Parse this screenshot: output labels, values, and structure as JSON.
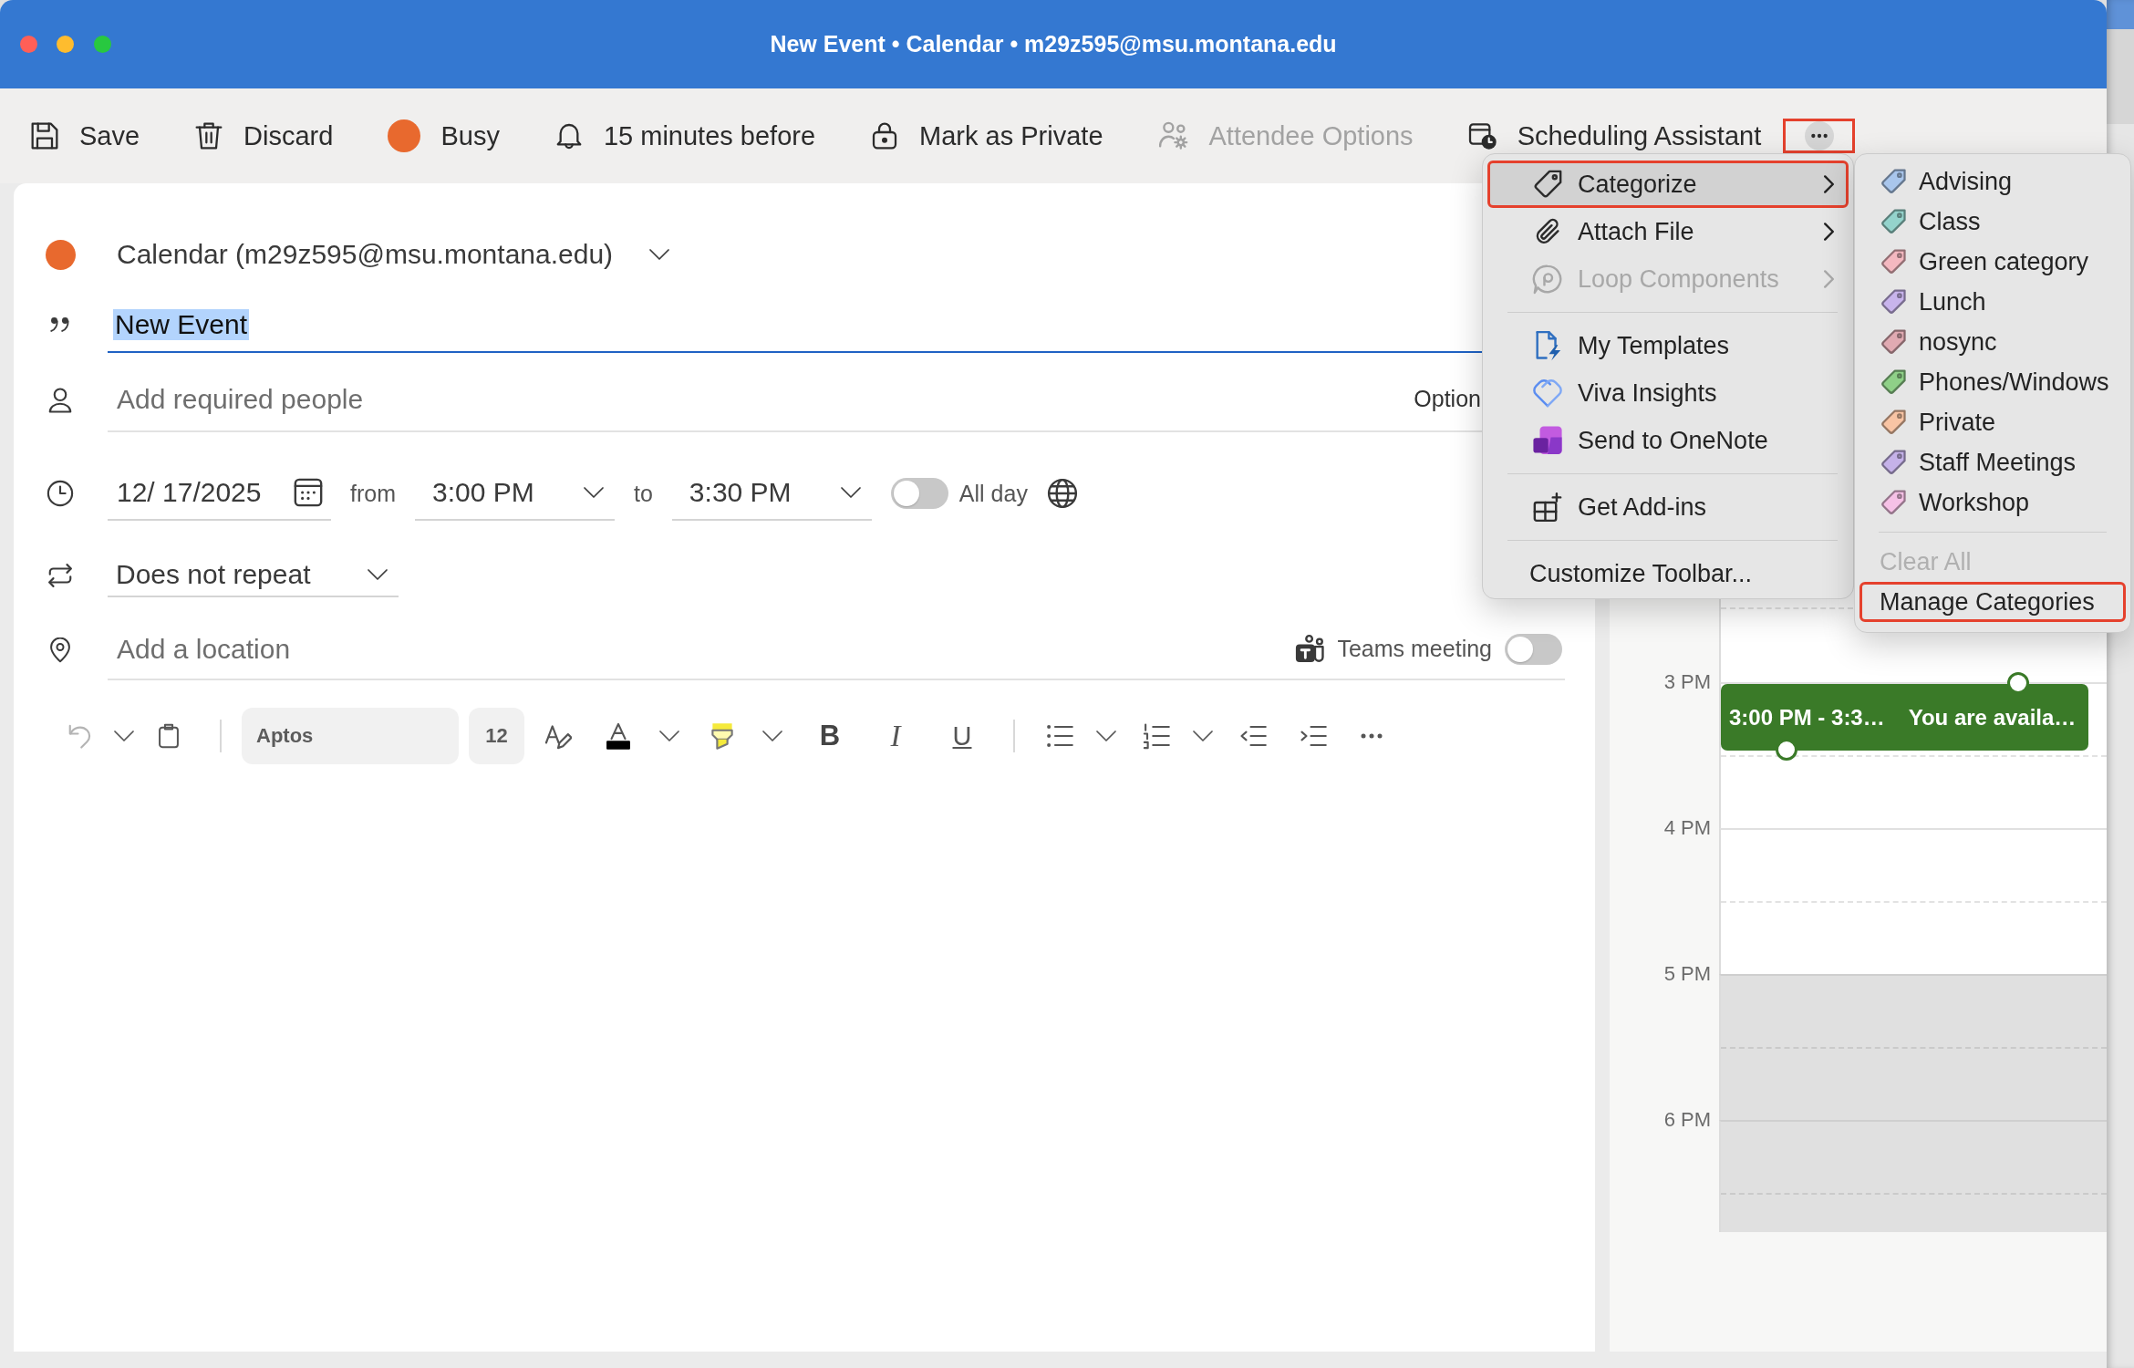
{
  "window": {
    "title": "New Event • Calendar • m29z595@msu.montana.edu"
  },
  "toolbar": {
    "buttons": [
      {
        "label": "Save",
        "disabled": false
      },
      {
        "label": "Discard",
        "disabled": false
      },
      {
        "label": "Busy",
        "disabled": false
      },
      {
        "label": "15 minutes before",
        "disabled": false
      },
      {
        "label": "Mark as Private",
        "disabled": false
      },
      {
        "label": "Attendee Options",
        "disabled": true
      },
      {
        "label": "Scheduling Assistant",
        "disabled": false
      }
    ],
    "more_button": {
      "highlighted": true
    }
  },
  "event_form": {
    "calendar": "Calendar (m29z595@msu.montana.edu)",
    "title": {
      "value": "New Event",
      "text_selected": true
    },
    "attendees": {
      "placeholder": "Add required people",
      "options_link": "Option"
    },
    "date": "12/ 17/2025",
    "from_label": "from",
    "start_time": "3:00 PM",
    "to_label": "to",
    "end_time": "3:30 PM",
    "all_day": {
      "label": "All day",
      "on": false
    },
    "repeat": "Does not repeat",
    "location": {
      "placeholder": "Add a location"
    },
    "teams_meeting": {
      "label": "Teams meeting",
      "on": false
    }
  },
  "format_toolbar": {
    "undo_disabled": true,
    "font": "Aptos",
    "size": "12",
    "bold": "B",
    "italic": "I",
    "underline": "U"
  },
  "more_menu": {
    "groups": [
      [
        {
          "label": "Categorize",
          "submenu": true,
          "disabled": false,
          "selected": true,
          "highlighted": true
        },
        {
          "label": "Attach File",
          "submenu": true,
          "disabled": false,
          "selected": false,
          "highlighted": false
        },
        {
          "label": "Loop Components",
          "submenu": true,
          "disabled": true,
          "selected": false,
          "highlighted": false
        }
      ],
      [
        {
          "label": "My Templates",
          "submenu": false,
          "disabled": false,
          "selected": false,
          "highlighted": false
        },
        {
          "label": "Viva Insights",
          "submenu": false,
          "disabled": false,
          "selected": false,
          "highlighted": false
        },
        {
          "label": "Send to OneNote",
          "submenu": false,
          "disabled": false,
          "selected": false,
          "highlighted": false
        }
      ],
      [
        {
          "label": "Get Add-ins",
          "submenu": false,
          "disabled": false,
          "selected": false,
          "highlighted": false
        }
      ],
      [
        {
          "label": "Customize Toolbar...",
          "submenu": false,
          "disabled": false,
          "selected": false,
          "highlighted": false
        }
      ]
    ]
  },
  "categorize_submenu": {
    "categories": [
      {
        "label": "Advising",
        "color": "#a9c6ec"
      },
      {
        "label": "Class",
        "color": "#94d3cc"
      },
      {
        "label": "Green category",
        "color": "#f4b8c0"
      },
      {
        "label": "Lunch",
        "color": "#c8b4ec"
      },
      {
        "label": "nosync",
        "color": "#e0aab2"
      },
      {
        "label": "Phones/Windows",
        "color": "#8fd088"
      },
      {
        "label": "Private",
        "color": "#f8c4a4"
      },
      {
        "label": "Staff Meetings",
        "color": "#c5b2e9"
      },
      {
        "label": "Workshop",
        "color": "#f6c1e6"
      }
    ],
    "actions": [
      {
        "label": "Clear All",
        "disabled": true,
        "highlighted": false
      },
      {
        "label": "Manage Categories",
        "disabled": false,
        "highlighted": true
      }
    ]
  },
  "calendar_panel": {
    "hours": [
      {
        "label": "3 PM",
        "working": true
      },
      {
        "label": "4 PM",
        "working": true
      },
      {
        "label": "5 PM",
        "working": false
      },
      {
        "label": "6 PM",
        "working": false
      }
    ],
    "event": {
      "time": "3:00 PM - 3:3…",
      "status": "You are availa…"
    }
  }
}
